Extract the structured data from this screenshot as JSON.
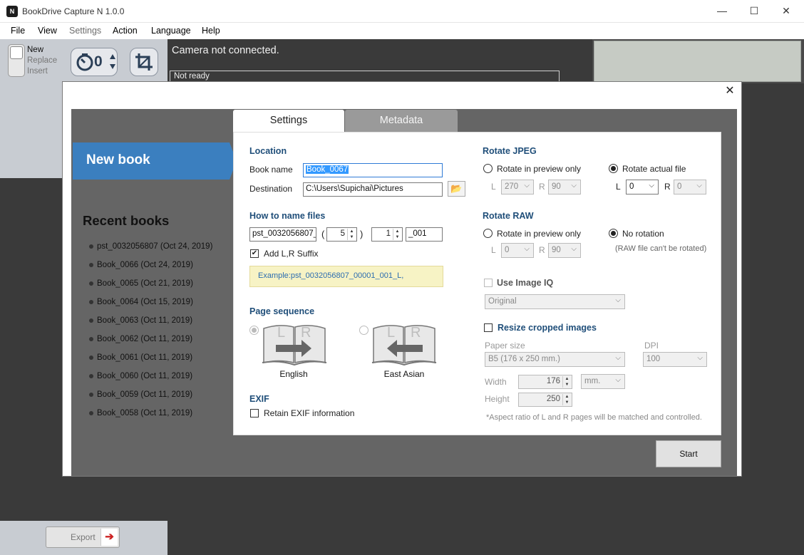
{
  "app": {
    "title": "BookDrive Capture N 1.0.0",
    "icon_letter": "N",
    "window_controls": {
      "minimize": "—",
      "maximize": "☐",
      "close": "✕"
    }
  },
  "menu": {
    "file": "File",
    "view": "View",
    "settings": "Settings",
    "action": "Action",
    "language": "Language",
    "help": "Help"
  },
  "toolbar": {
    "modes": {
      "new": "New",
      "replace": "Replace",
      "insert": "Insert"
    },
    "timer_value": "0",
    "camera_status": "Camera not connected.",
    "ready_status": "Not ready"
  },
  "export": {
    "label": "Export",
    "arrow": "➔"
  },
  "dialog": {
    "close": "✕",
    "new_book": "New book",
    "recent_title": "Recent books",
    "recent_books": [
      "pst_0032056807 (Oct 24, 2019)",
      "Book_0066 (Oct 24, 2019)",
      "Book_0065 (Oct 21, 2019)",
      "Book_0064 (Oct 15, 2019)",
      "Book_0063 (Oct 11, 2019)",
      "Book_0062 (Oct 11, 2019)",
      "Book_0061 (Oct 11, 2019)",
      "Book_0060 (Oct 11, 2019)",
      "Book_0059 (Oct 11, 2019)",
      "Book_0058 (Oct 11, 2019)"
    ],
    "tabs": {
      "settings": "Settings",
      "metadata": "Metadata"
    },
    "location": {
      "title": "Location",
      "book_name_label": "Book name",
      "book_name_value": "Book_0067",
      "destination_label": "Destination",
      "destination_value": "C:\\Users\\Supichai\\Pictures"
    },
    "naming": {
      "title": "How to name files",
      "prefix": "pst_0032056807_",
      "open_paren": "(",
      "digits": "5",
      "close_paren": ")",
      "start": "1",
      "suffix": "_001",
      "add_lr_label": "Add L,R Suffix",
      "add_lr_checked": true,
      "example": "Example:pst_0032056807_00001_001_L,"
    },
    "page_sequence": {
      "title": "Page sequence",
      "english": "English",
      "east_asian": "East Asian",
      "book_letters": {
        "left": "L",
        "right": "R"
      }
    },
    "exif": {
      "title": "EXIF",
      "retain_label": "Retain EXIF information"
    },
    "rotate_jpeg": {
      "title": "Rotate JPEG",
      "preview_only": "Rotate in preview only",
      "actual_file": "Rotate actual file",
      "selected": "actual_file",
      "preview_L_label": "L",
      "preview_L": "270",
      "preview_R_label": "R",
      "preview_R": "90",
      "actual_L_label": "L",
      "actual_L": "0",
      "actual_R_label": "R",
      "actual_R": "0"
    },
    "rotate_raw": {
      "title": "Rotate RAW",
      "preview_only": "Rotate in preview only",
      "no_rotation": "No rotation",
      "selected": "no_rotation",
      "L_label": "L",
      "L": "0",
      "R_label": "R",
      "R": "90",
      "note": "(RAW file can't be rotated)"
    },
    "image_iq": {
      "label": "Use Image IQ",
      "value": "Original"
    },
    "resize": {
      "label": "Resize cropped images",
      "paper_size_label": "Paper size",
      "paper_size_value": "B5 (176 x 250 mm.)",
      "dpi_label": "DPI",
      "dpi_value": "100",
      "width_label": "Width",
      "width_value": "176",
      "height_label": "Height",
      "height_value": "250",
      "unit": "mm.",
      "note": "*Aspect ratio of L and R pages will be matched and controlled."
    },
    "start_button": "Start"
  },
  "colors": {
    "accent_blue": "#3b7fbf",
    "section_title": "#1f4e79",
    "dark_bg": "#3a3a3a",
    "dialog_bg": "#656565"
  }
}
